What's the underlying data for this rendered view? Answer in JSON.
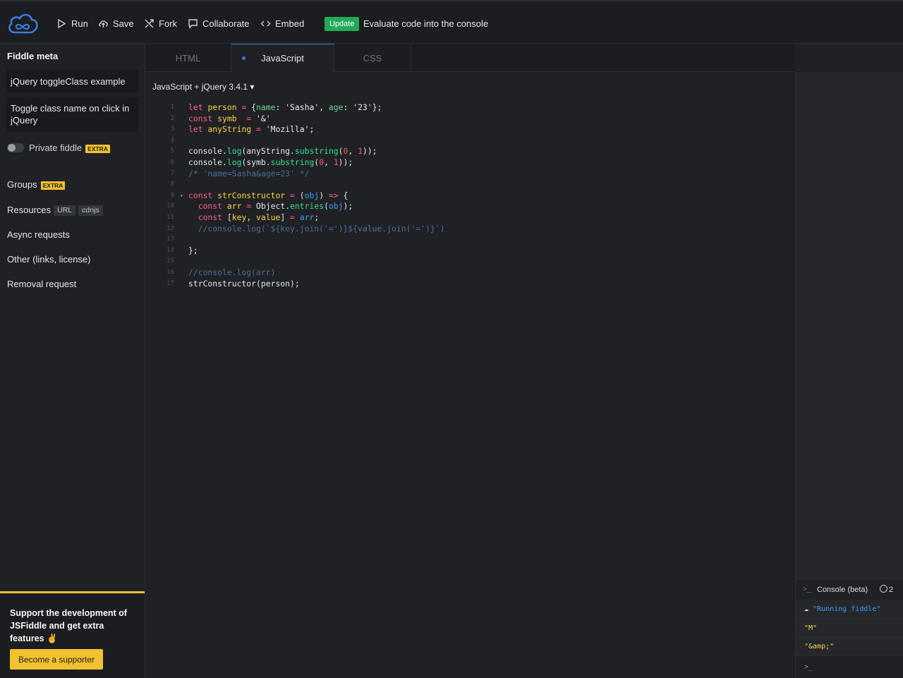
{
  "toolbar": {
    "run": "Run",
    "save": "Save",
    "fork": "Fork",
    "collaborate": "Collaborate",
    "embed": "Embed",
    "update_badge": "Update",
    "update_text": "Evaluate code into the console"
  },
  "sidebar": {
    "title": "Fiddle meta",
    "fiddle_title": "jQuery toggleClass example",
    "fiddle_description": "Toggle class name on click in jQuery",
    "private_label": "Private fiddle",
    "extra_badge": "EXTRA",
    "groups": "Groups",
    "resources": "Resources",
    "resources_url": "URL",
    "resources_cdnjs": "cdnjs",
    "async": "Async requests",
    "other": "Other (links, license)",
    "removal": "Removal request",
    "support_text": "Support the development of JSFiddle and get extra features ✌",
    "support_button": "Become a supporter"
  },
  "tabs": [
    {
      "label": "HTML"
    },
    {
      "label": "JavaScript"
    },
    {
      "label": "CSS"
    }
  ],
  "editor": {
    "language": "JavaScript + jQuery 3.4.1 ▾"
  },
  "console": {
    "title": "Console (beta)",
    "count": "2",
    "messages": [
      "\"Running fiddle\"",
      "\"M\"",
      "\"&amp;\""
    ],
    "prompt": ">_"
  },
  "code_lines": [
    "let person = {name: 'Sasha', age: '23'};",
    "const symb  = '&'",
    "let anyString = 'Mozilla';",
    "",
    "console.log(anyString.substring(0, 1));",
    "console.log(symb.substring(0, 1));",
    "/* 'name=Sasha&age=23' */",
    "",
    "const strConstructor = (obj) => {",
    "  const arr = Object.entries(obj);",
    "  const [key, value] = arr;",
    "  //console.log(`${key.join('=')}${value.join('=')}`)",
    "",
    "};",
    "",
    "//console.log(arr)",
    "strConstructor(person);"
  ]
}
